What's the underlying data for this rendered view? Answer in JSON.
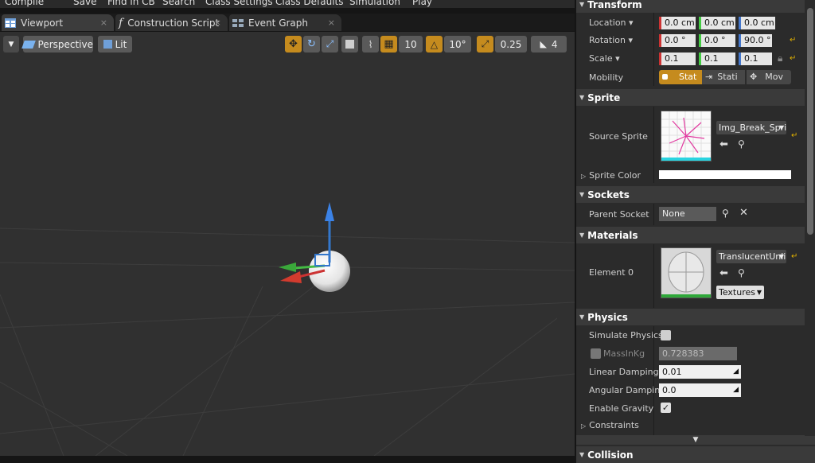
{
  "toolbar": {
    "items": [
      "Compile",
      "Save",
      "Find in CB",
      "Search",
      "Class Settings",
      "Class Defaults",
      "Simulation",
      "Play"
    ]
  },
  "tabs": [
    {
      "label": "Viewport",
      "icon": "viewport-grid-icon"
    },
    {
      "label": "Construction Script",
      "icon": "function-icon",
      "glyph": "f"
    },
    {
      "label": "Event Graph",
      "icon": "graph-icon"
    }
  ],
  "viewport_toolbar": {
    "perspective": "Perspective",
    "lit": "Lit",
    "grid_snap": "10",
    "rotation_snap": "10°",
    "scale_snap": "0.25",
    "camera_speed": "4"
  },
  "details": {
    "transform": {
      "title": "Transform",
      "location_label": "Location",
      "location": [
        "0.0 cm",
        "0.0 cm",
        "0.0 cm"
      ],
      "rotation_label": "Rotation",
      "rotation": [
        "0.0 °",
        "0.0 °",
        "90.0 °"
      ],
      "scale_label": "Scale",
      "scale": [
        "0.1",
        "0.1",
        "0.1"
      ],
      "mobility_label": "Mobility",
      "mobility": [
        "Stat",
        "Stati",
        "Mov"
      ]
    },
    "sprite": {
      "title": "Sprite",
      "source_label": "Source Sprite",
      "source_value": "Img_Break_Spri",
      "color_label": "Sprite Color"
    },
    "sockets": {
      "title": "Sockets",
      "parent_label": "Parent Socket",
      "parent_value": "None"
    },
    "materials": {
      "title": "Materials",
      "element_label": "Element 0",
      "element_value": "TranslucentUnli",
      "textures_label": "Textures"
    },
    "physics": {
      "title": "Physics",
      "simulate_label": "Simulate Physics",
      "mass_label": "MassInKg",
      "mass_value": "0.728383",
      "linear_label": "Linear Damping",
      "linear_value": "0.01",
      "angular_label": "Angular Damping",
      "angular_value": "0.0",
      "gravity_label": "Enable Gravity",
      "constraints_label": "Constraints"
    },
    "collision": {
      "title": "Collision"
    }
  },
  "colors": {
    "accent": "#c58b1e",
    "x_axis": "#cc3333",
    "y_axis": "#44bb44",
    "z_axis": "#3377cc"
  }
}
